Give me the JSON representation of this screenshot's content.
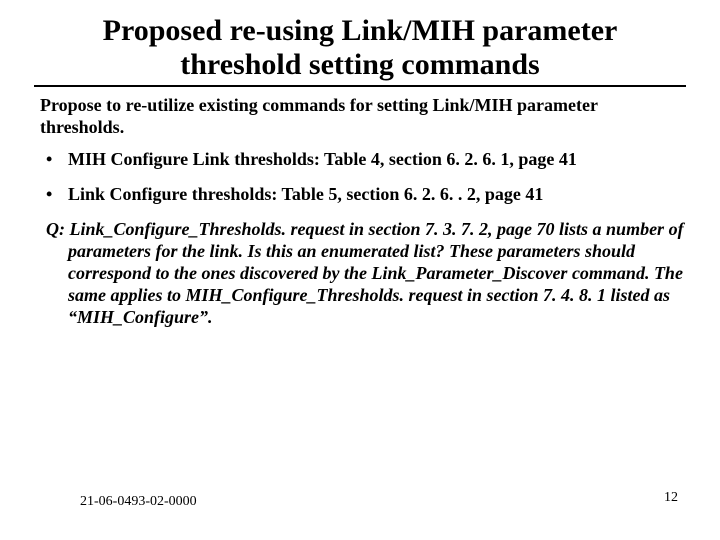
{
  "title": "Proposed re-using Link/MIH parameter threshold  setting commands",
  "intro": "Propose to re-utilize existing commands for setting Link/MIH parameter thresholds.",
  "bullets": [
    "MIH Configure Link thresholds: Table 4, section 6. 2. 6. 1, page 41",
    "Link Configure thresholds: Table 5, section 6. 2. 6. . 2, page 41"
  ],
  "question": "Q: Link_Configure_Thresholds. request in section 7. 3. 7. 2, page 70 lists a number of parameters for the link. Is this an enumerated list? These parameters should correspond to the ones discovered by the Link_Parameter_Discover command. The same applies to MIH_Configure_Thresholds. request in section 7. 4. 8. 1 listed as “MIH_Configure”.",
  "footer_left": "21-06-0493-02-0000",
  "page_number": "12"
}
